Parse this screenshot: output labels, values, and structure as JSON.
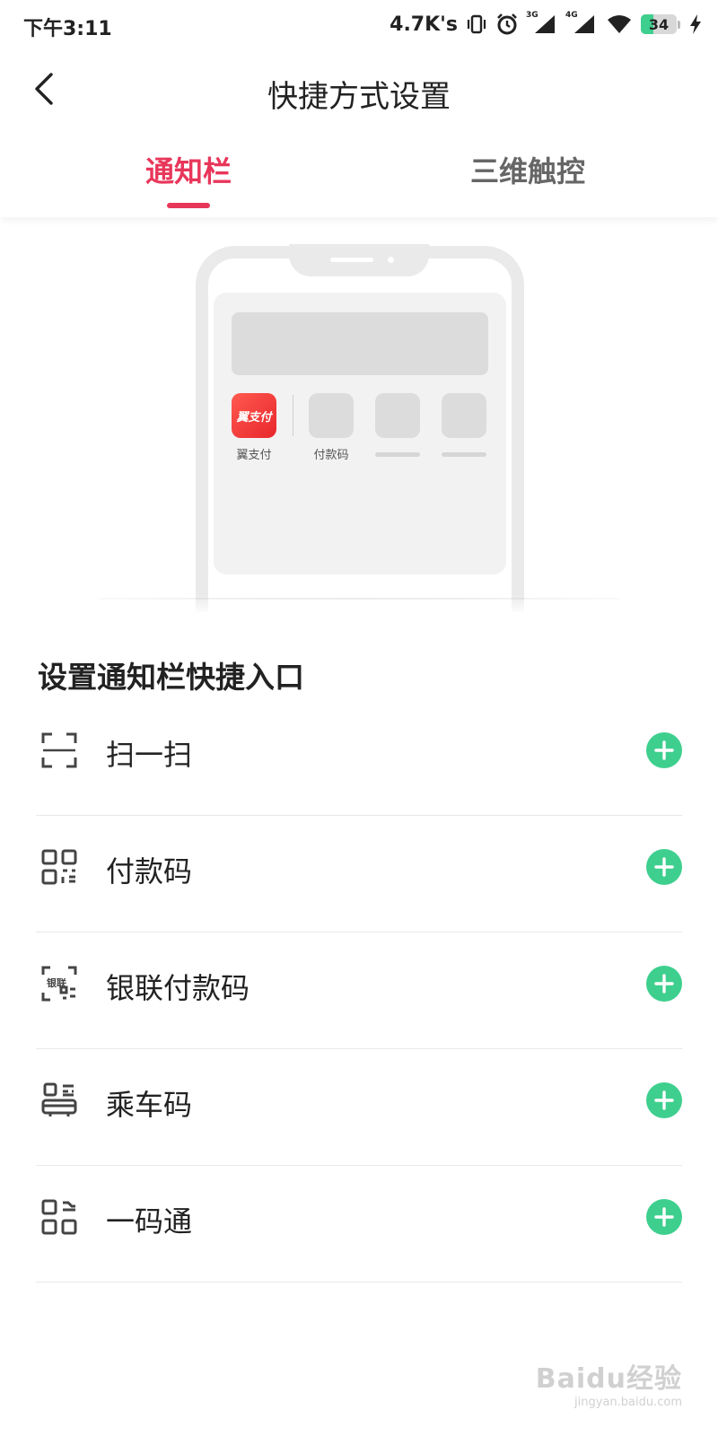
{
  "status_bar": {
    "time": "下午3:11",
    "net_speed": "4.7K's",
    "signal_1_label": "3G",
    "signal_2_label": "4G",
    "battery_level": "34",
    "battery_percent": 34,
    "icons": [
      "vibrate-icon",
      "alarm-icon",
      "signal-3g-icon",
      "signal-4g-icon",
      "wifi-icon",
      "battery-icon",
      "charging-icon"
    ]
  },
  "header": {
    "title": "快捷方式设置",
    "back_icon": "chevron-left-icon"
  },
  "tabs": [
    {
      "label": "通知栏",
      "active": true
    },
    {
      "label": "三维触控",
      "active": false
    }
  ],
  "illustration": {
    "app_logo_text": "翼支付",
    "app_1_label": "翼支付",
    "app_2_label": "付款码"
  },
  "section": {
    "title": "设置通知栏快捷入口",
    "items": [
      {
        "label": "扫一扫",
        "icon": "scan-icon"
      },
      {
        "label": "付款码",
        "icon": "qrcode-icon"
      },
      {
        "label": "银联付款码",
        "icon": "unionpay-qrcode-icon"
      },
      {
        "label": "乘车码",
        "icon": "bus-code-icon"
      },
      {
        "label": "一码通",
        "icon": "unified-code-icon"
      }
    ],
    "add_icon": "plus-circle-icon"
  },
  "watermark": {
    "brand": "Baidu经验",
    "url": "jingyan.baidu.com"
  },
  "colors": {
    "accent": "#e8365a",
    "add": "#3ecf8e",
    "tab_inactive": "#666666"
  }
}
